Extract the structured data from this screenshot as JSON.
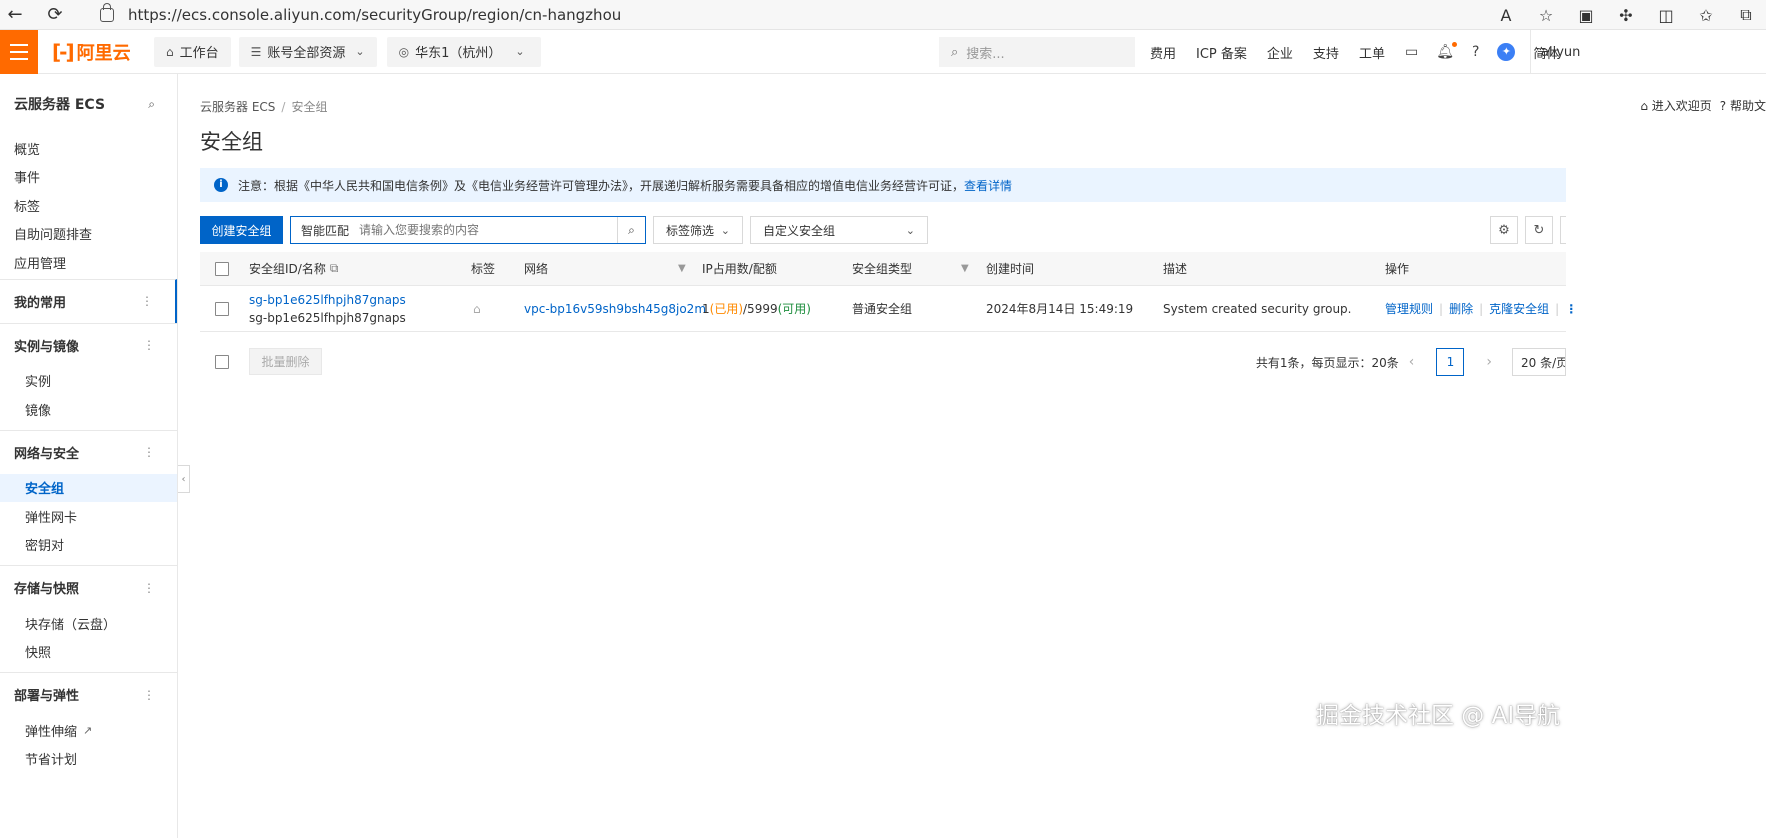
{
  "browser": {
    "url": "https://ecs.console.aliyun.com/securityGroup/region/cn-hangzhou"
  },
  "topbar": {
    "logo_text": "阿里云",
    "workbench": "工作台",
    "resources": "账号全部资源",
    "region": "华东1（杭州）",
    "search_placeholder": "搜索...",
    "links": [
      "费用",
      "ICP 备案",
      "企业",
      "支持",
      "工单"
    ],
    "lang": "简体",
    "user": "aliyun"
  },
  "sidebar": {
    "title": "云服务器 ECS",
    "top_items": [
      "概览",
      "事件",
      "标签",
      "自助问题排查",
      "应用管理"
    ],
    "groups": [
      {
        "label": "我的常用",
        "items": []
      },
      {
        "label": "实例与镜像",
        "items": [
          "实例",
          "镜像"
        ]
      },
      {
        "label": "网络与安全",
        "items": [
          "安全组",
          "弹性网卡",
          "密钥对"
        ]
      },
      {
        "label": "存储与快照",
        "items": [
          "块存储（云盘）",
          "快照"
        ]
      },
      {
        "label": "部署与弹性",
        "items": [
          "弹性伸缩",
          "节省计划"
        ]
      }
    ]
  },
  "main": {
    "breadcrumb": [
      "云服务器 ECS",
      "安全组"
    ],
    "welcome": "进入欢迎页",
    "help": "帮助文",
    "title": "安全组",
    "notice_text": "注意：根据《中华人民共和国电信条例》及《电信业务经营许可管理办法》，开展递归解析服务需要具备相应的增值电信业务经营许可证，",
    "notice_link": "查看详情",
    "create_btn": "创建安全组",
    "search_type": "智能匹配",
    "search_placeholder": "请输入您要搜索的内容",
    "tag_filter": "标签筛选",
    "custom_select": "自定义安全组",
    "columns": [
      "安全组ID/名称",
      "标签",
      "网络",
      "IP占用数/配额",
      "安全组类型",
      "创建时间",
      "描述",
      "操作"
    ],
    "rows": [
      {
        "id": "sg-bp1e625lfhpjh87gnaps",
        "name": "sg-bp1e625lfhpjh87gnaps",
        "vpc": "vpc-bp16v59sh9bsh45g8jo2m",
        "ip_used": "1",
        "ip_used_label": "(已用)",
        "ip_quota": "/5999",
        "ip_quota_label": "(可用)",
        "type": "普通安全组",
        "created": "2024年8月14日 15:49:19",
        "desc": "System created security group.",
        "ops": [
          "管理规则",
          "删除",
          "克隆安全组"
        ]
      }
    ],
    "batch_delete": "批量删除",
    "pager_total": "共有1条，每页显示：20条",
    "pager_current": "1",
    "pager_size": "20 条/页"
  },
  "watermark": "掘金技术社区 @ AI导航",
  "colors": {
    "brand": "#ff6a00",
    "primary": "#0064c8"
  }
}
